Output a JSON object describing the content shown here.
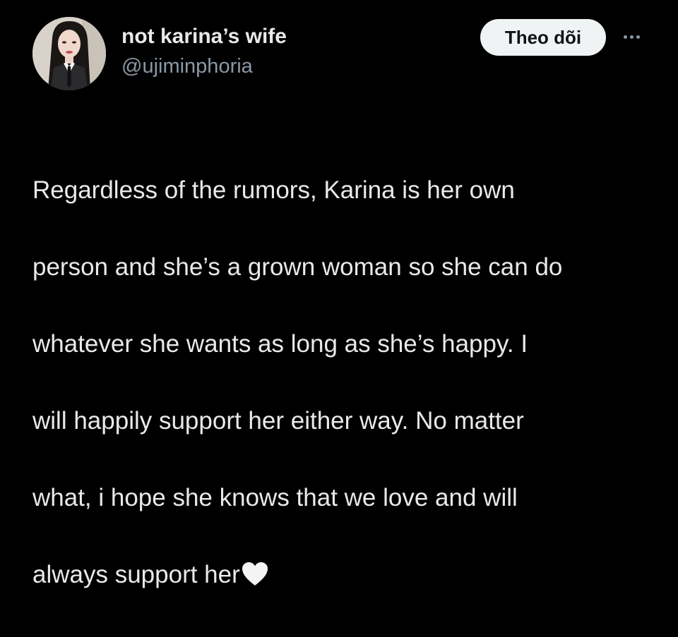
{
  "author": {
    "display_name": "not karina’s wife",
    "handle": "@ujiminphoria",
    "avatar_icon": "profile-photo"
  },
  "actions": {
    "follow_label": "Theo dõi",
    "more_icon": "more-horizontal-icon"
  },
  "tweet": {
    "lines": [
      "Regardless of the rumors, Karina is her own",
      "person and she’s a grown woman so she can do",
      "whatever she wants as long as she’s happy. I",
      "will happily support her either way. No matter",
      "what, i hope she knows that we love and will",
      "always support her"
    ],
    "emoji": "white-heart-icon"
  },
  "colors": {
    "background": "#000000",
    "text_primary": "#e7e9ea",
    "text_secondary": "#8b98a5",
    "follow_button_bg": "#eff3f4"
  }
}
